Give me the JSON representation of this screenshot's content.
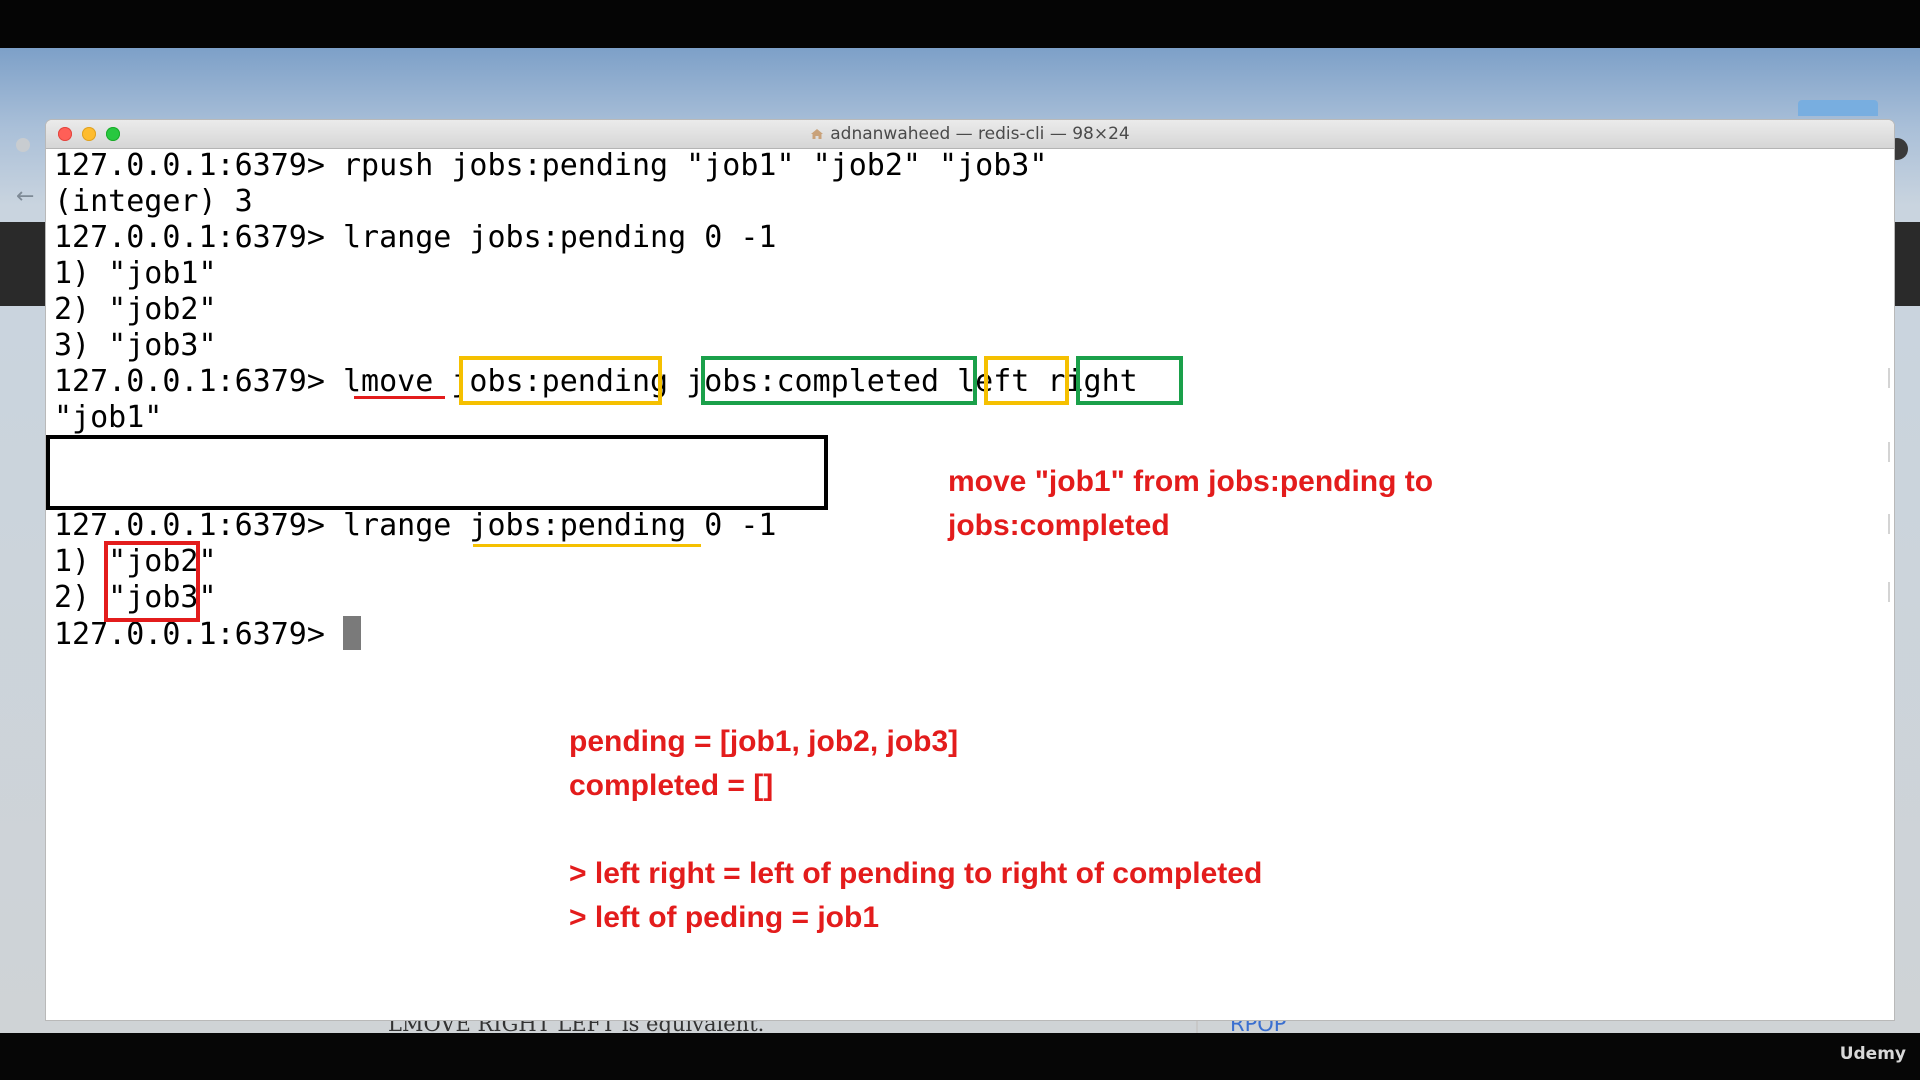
{
  "window": {
    "title": "adnanwaheed — redis-cli — 98×24"
  },
  "terminal": {
    "lines": [
      "127.0.0.1:6379> rpush jobs:pending \"job1\" \"job2\" \"job3\"",
      "(integer) 3",
      "127.0.0.1:6379> lrange jobs:pending 0 -1",
      "1) \"job1\"",
      "2) \"job2\"",
      "3) \"job3\"",
      "127.0.0.1:6379> lmove jobs:pending jobs:completed left right",
      "\"job1\"",
      "",
      "127.0.0.1:6379> lrange jobs:pending 0 -1",
      "1) \"job2\"",
      "2) \"job3\"",
      "127.0.0.1:6379> "
    ]
  },
  "annotations": {
    "note1": "move \"job1\" from jobs:pending to\njobs:completed",
    "note2": "pending = [job1, job2, job3]\ncompleted = []\n\n> left right = left of pending to right of completed\n> left of peding = job1"
  },
  "colors": {
    "note_red": "#e31c1c",
    "highlight_yellow": "#f5c000",
    "highlight_green": "#1aa04a",
    "highlight_red": "#e31c1c",
    "highlight_black": "#000000"
  },
  "background": {
    "peek_left": "LMOVE RIGHT LEFT is equivalent.",
    "peek_right": "RPOP",
    "brand": "Udemy"
  }
}
